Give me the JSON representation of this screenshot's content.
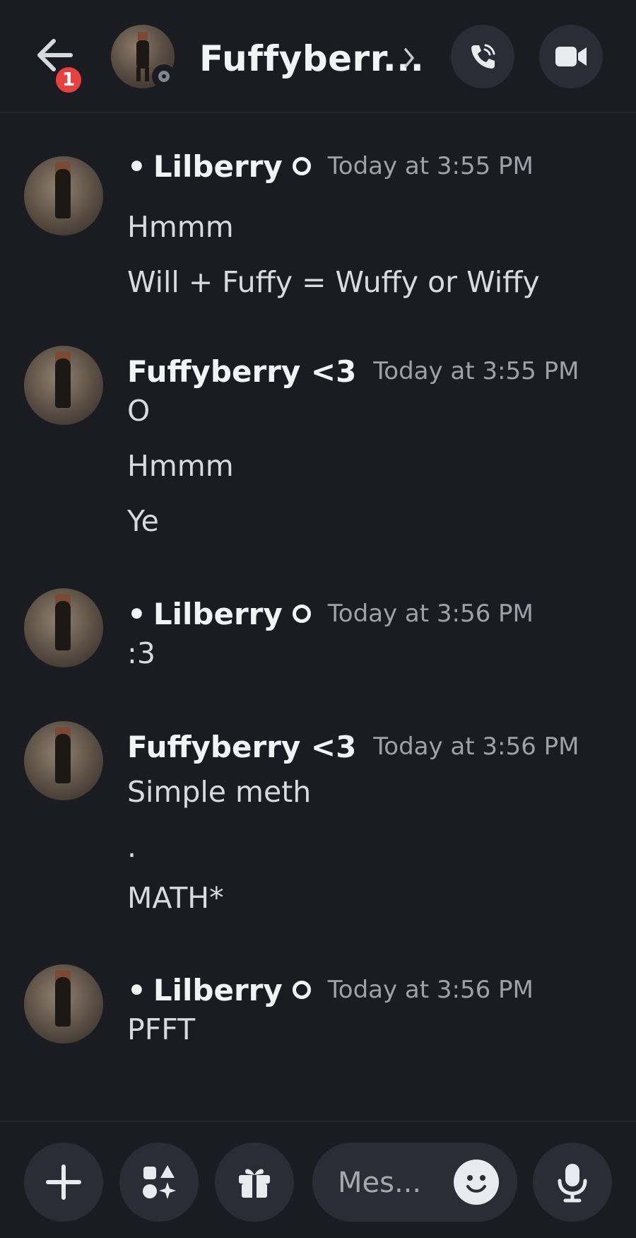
{
  "header": {
    "back_icon": "arrow-left-icon",
    "notification_count": "1",
    "title": "Fuffyberr...",
    "call_icon": "phone-icon",
    "video_icon": "video-camera-icon",
    "status_color": "#82858f"
  },
  "messages": [
    {
      "prefix": "•",
      "author": "Lilberry",
      "time": "Today at 3:55 PM",
      "lines": [
        "Hmmm",
        "Will + Fuffy = Wuffy or Wiffy"
      ]
    },
    {
      "prefix": "",
      "author": "Fuffyberry <3",
      "time": "Today at 3:55 PM",
      "lines": [
        "O",
        "Hmmm",
        "Ye"
      ]
    },
    {
      "prefix": "•",
      "author": "Lilberry",
      "time": "Today at 3:56 PM",
      "lines": [
        ":3"
      ]
    },
    {
      "prefix": "",
      "author": "Fuffyberry <3",
      "time": "Today at 3:56 PM",
      "lines": [
        "Simple meth",
        ".",
        "MATH*"
      ]
    },
    {
      "prefix": "•",
      "author": "Lilberry",
      "time": "Today at 3:56 PM",
      "lines": [
        "PFFT"
      ]
    }
  ],
  "composer": {
    "placeholder": "Mes...",
    "add_icon": "plus-icon",
    "apps_icon": "apps-icon",
    "gift_icon": "gift-icon",
    "emoji_icon": "emoji-icon",
    "mic_icon": "microphone-icon"
  },
  "colors": {
    "background": "#1a1c22",
    "button_bg": "#2b2d36",
    "badge": "#e8403f",
    "timestamp": "#9ea1aa"
  }
}
